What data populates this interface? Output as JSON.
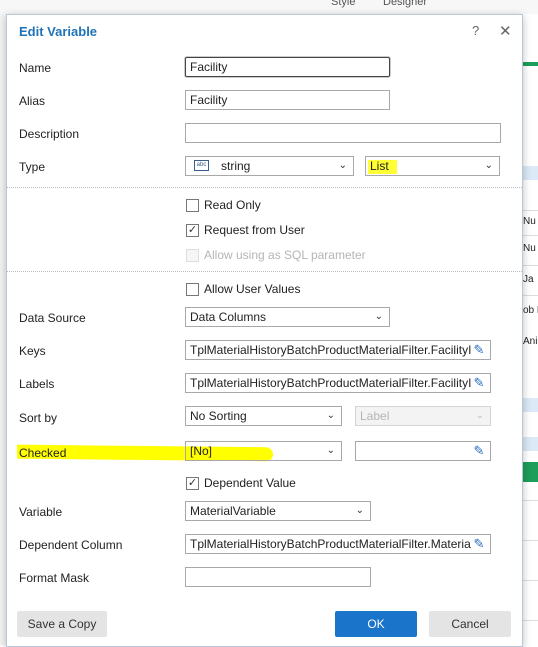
{
  "background": {
    "top_labels": [
      "Style",
      "Designer"
    ],
    "right_labels": [
      "Nu",
      "Nu",
      "Ja",
      "ob L",
      "Anis"
    ]
  },
  "dialog": {
    "title": "Edit Variable",
    "help_glyph": "?",
    "close_glyph": "✕"
  },
  "form": {
    "name_label": "Name",
    "name_value": "Facility",
    "alias_label": "Alias",
    "alias_value": "Facility",
    "description_label": "Description",
    "description_value": "",
    "type_label": "Type",
    "type_icon_text": "abc",
    "type_value": "string",
    "type_kind_value": "List",
    "read_only_label": "Read Only",
    "read_only_checked": false,
    "request_from_user_label": "Request from User",
    "request_from_user_checked": true,
    "allow_sql_label": "Allow using as SQL parameter",
    "allow_sql_checked": false,
    "allow_user_values_label": "Allow User Values",
    "allow_user_values_checked": false,
    "data_source_label": "Data Source",
    "data_source_value": "Data Columns",
    "keys_label": "Keys",
    "keys_value": "TplMaterialHistoryBatchProductMaterialFilter.FacilityI",
    "labels_label": "Labels",
    "labels_value": "TplMaterialHistoryBatchProductMaterialFilter.FacilityI",
    "sort_by_label": "Sort by",
    "sort_by_value": "No Sorting",
    "sort_field_placeholder": "Label",
    "checked_label": "Checked",
    "checked_value": "[No]",
    "checked_expr_value": "",
    "dependent_value_label": "Dependent Value",
    "dependent_value_checked": true,
    "variable_label": "Variable",
    "variable_value": "MaterialVariable",
    "dependent_column_label": "Dependent Column",
    "dependent_column_value": "TplMaterialHistoryBatchProductMaterialFilter.Materia",
    "format_mask_label": "Format Mask",
    "format_mask_value": ""
  },
  "buttons": {
    "save_copy": "Save a Copy",
    "ok": "OK",
    "cancel": "Cancel"
  },
  "colors": {
    "title": "#1f72b8",
    "ok_button": "#1a74c9",
    "highlight": "#ffff00"
  }
}
